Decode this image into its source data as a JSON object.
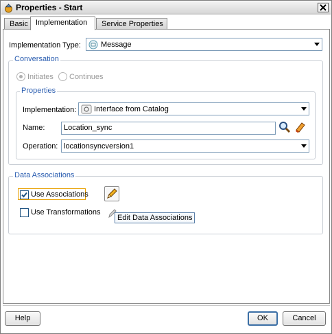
{
  "window": {
    "title": "Properties - Start"
  },
  "tabs": [
    {
      "label": "Basic"
    },
    {
      "label": "Implementation"
    },
    {
      "label": "Service Properties"
    }
  ],
  "implementation_type": {
    "label": "Implementation Type:",
    "value": "Message"
  },
  "conversation": {
    "title": "Conversation",
    "initiates": "Initiates",
    "continues": "Continues"
  },
  "properties": {
    "title": "Properties",
    "implementation_label": "Implementation:",
    "implementation_value": "Interface from Catalog",
    "name_label": "Name:",
    "name_value": "Location_sync",
    "operation_label": "Operation:",
    "operation_value": "locationsyncversion1"
  },
  "data_associations": {
    "title": "Data Associations",
    "use_associations": "Use Associations",
    "use_transformations": "Use Transformations",
    "tooltip": "Edit Data Associations"
  },
  "buttons": {
    "help": "Help",
    "ok": "OK",
    "cancel": "Cancel"
  },
  "colors": {
    "group_title": "#2a5db0",
    "accent": "#3a6ea5"
  }
}
